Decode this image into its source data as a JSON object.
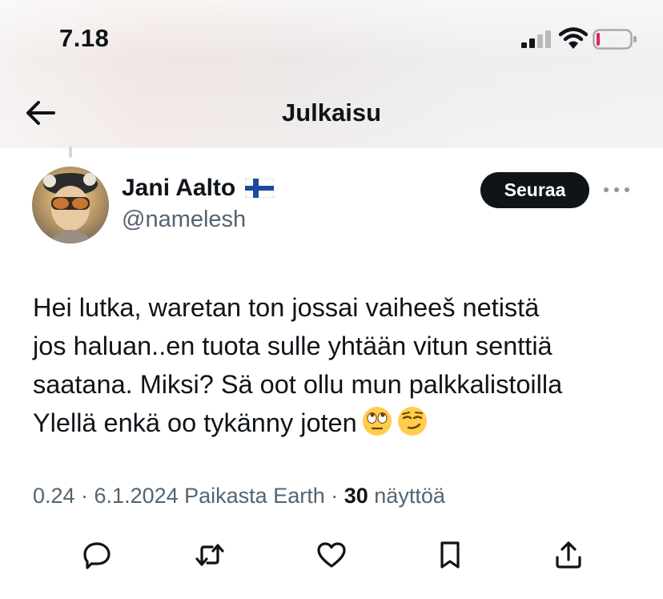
{
  "status_bar": {
    "time": "7.18",
    "icons": [
      "cellular-signal-icon",
      "wifi-icon",
      "battery-low-icon"
    ]
  },
  "nav": {
    "back_icon": "arrow-left-icon",
    "title": "Julkaisu"
  },
  "author": {
    "name": "Jani Aalto",
    "flag": "finland-flag-icon",
    "handle": "@namelesh"
  },
  "follow_button": {
    "label": "Seuraa"
  },
  "more_icon": "more-dots-icon",
  "tweet": {
    "text": "Hei lutka, waretan ton jossai vaiheeš netistä\njos haluan..en tuota sulle yhtään vitun senttiä\nsaatana. Miksi? Sä oot ollu mun palkkalistoilla\nYlellä enkä oo tykänny joten",
    "emojis": [
      "eye-roll-emoji",
      "smirk-emoji"
    ]
  },
  "meta": {
    "prefix": "0.24 · 6.1.2024 Paikasta Earth · ",
    "views_count": "30",
    "views_label": " näyttöä"
  },
  "actions": [
    "reply-icon",
    "repost-icon",
    "like-icon",
    "bookmark-icon",
    "share-icon"
  ],
  "colors": {
    "text_primary": "#0f1419",
    "text_secondary": "#536471",
    "button_dark": "#0f1419",
    "battery_low": "#e0245e"
  }
}
